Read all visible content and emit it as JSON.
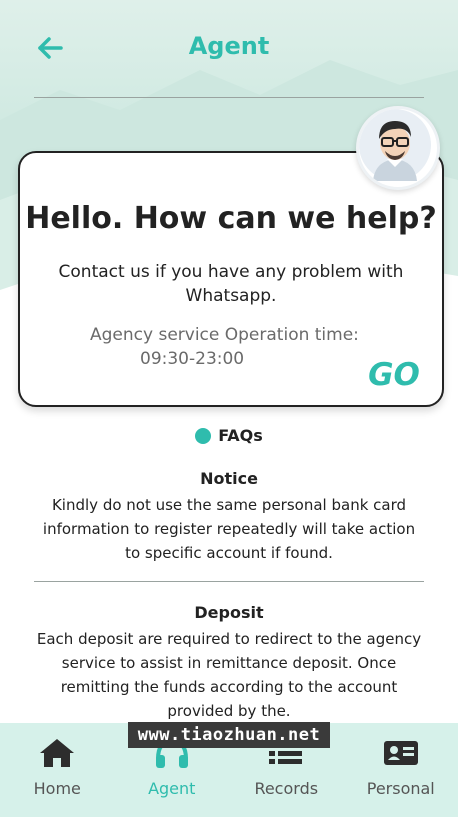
{
  "header": {
    "title": "Agent"
  },
  "card": {
    "title": "Hello. How can we help?",
    "subtitle": "Contact us if you have any problem with Whatsapp.",
    "time_label": "Agency service Operation time:",
    "time_value": "09:30-23:00",
    "go_label": "GO"
  },
  "faqs": {
    "label": "FAQs"
  },
  "sections": [
    {
      "heading": "Notice",
      "body": "Kindly do not use the same personal bank card information to register repeatedly will take action to specific account if found."
    },
    {
      "heading": "Deposit",
      "body": "Each deposit are required to redirect to the agency service to assist in remittance deposit. Once remitting the funds according to the account provided by the."
    }
  ],
  "nav": [
    {
      "label": "Home",
      "icon": "home-icon"
    },
    {
      "label": "Agent",
      "icon": "headphones-icon"
    },
    {
      "label": "Records",
      "icon": "list-icon"
    },
    {
      "label": "Personal",
      "icon": "id-card-icon"
    }
  ],
  "watermark": "www.tiaozhuan.net",
  "colors": {
    "accent": "#2fbcad",
    "nav_bg": "#d6f1ea"
  }
}
